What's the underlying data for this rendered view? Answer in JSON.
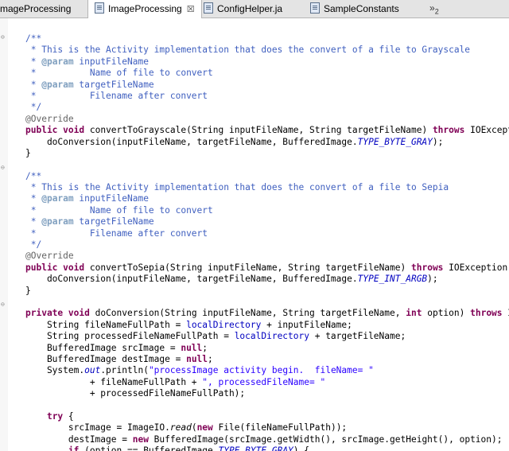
{
  "tabs": [
    {
      "label": "mageProcessing",
      "active": false,
      "icon": "none"
    },
    {
      "label": "ImageProcessing",
      "active": true,
      "icon": "java-file-icon",
      "close": "☒"
    },
    {
      "label": "ConfigHelper.ja",
      "active": false,
      "icon": "java-file-icon"
    },
    {
      "label": "SampleConstants",
      "active": false,
      "icon": "java-file-icon"
    }
  ],
  "overflow": {
    "arrows": "»",
    "count": "2"
  },
  "code_lines": [
    [
      {
        "t": "/**",
        "c": "jd"
      }
    ],
    [
      {
        "t": " * This is the Activity implementation that does the convert of a file to Grayscale",
        "c": "jd"
      }
    ],
    [
      {
        "t": " * ",
        "c": "jd"
      },
      {
        "t": "@param",
        "c": "jdtag"
      },
      {
        "t": " inputFileName",
        "c": "jd"
      }
    ],
    [
      {
        "t": " *          Name of file to convert",
        "c": "jd"
      }
    ],
    [
      {
        "t": " * ",
        "c": "jd"
      },
      {
        "t": "@param",
        "c": "jdtag"
      },
      {
        "t": " targetFileName",
        "c": "jd"
      }
    ],
    [
      {
        "t": " *          Filename after convert",
        "c": "jd"
      }
    ],
    [
      {
        "t": " */",
        "c": "jd"
      }
    ],
    [
      {
        "t": "@Override",
        "c": "ann"
      }
    ],
    [
      {
        "t": "public",
        "c": "kw"
      },
      {
        "t": " ",
        "c": ""
      },
      {
        "t": "void",
        "c": "kw"
      },
      {
        "t": " convertToGrayscale(String inputFileName, String targetFileName) ",
        "c": ""
      },
      {
        "t": "throws",
        "c": "kw"
      },
      {
        "t": " IOExcept",
        "c": ""
      }
    ],
    [
      {
        "t": "    doConversion(inputFileName, targetFileName, BufferedImage.",
        "c": ""
      },
      {
        "t": "TYPE_BYTE_GRAY",
        "c": "sf"
      },
      {
        "t": ");",
        "c": ""
      }
    ],
    [
      {
        "t": "}",
        "c": ""
      }
    ],
    [
      {
        "t": "",
        "c": ""
      }
    ],
    [
      {
        "t": "/**",
        "c": "jd"
      }
    ],
    [
      {
        "t": " * This is the Activity implementation that does the convert of a file to Sepia",
        "c": "jd"
      }
    ],
    [
      {
        "t": " * ",
        "c": "jd"
      },
      {
        "t": "@param",
        "c": "jdtag"
      },
      {
        "t": " inputFileName",
        "c": "jd"
      }
    ],
    [
      {
        "t": " *          Name of file to convert",
        "c": "jd"
      }
    ],
    [
      {
        "t": " * ",
        "c": "jd"
      },
      {
        "t": "@param",
        "c": "jdtag"
      },
      {
        "t": " targetFileName",
        "c": "jd"
      }
    ],
    [
      {
        "t": " *          Filename after convert",
        "c": "jd"
      }
    ],
    [
      {
        "t": " */",
        "c": "jd"
      }
    ],
    [
      {
        "t": "@Override",
        "c": "ann"
      }
    ],
    [
      {
        "t": "public",
        "c": "kw"
      },
      {
        "t": " ",
        "c": ""
      },
      {
        "t": "void",
        "c": "kw"
      },
      {
        "t": " convertToSepia(String inputFileName, String targetFileName) ",
        "c": ""
      },
      {
        "t": "throws",
        "c": "kw"
      },
      {
        "t": " IOException",
        "c": ""
      }
    ],
    [
      {
        "t": "    doConversion(inputFileName, targetFileName, BufferedImage.",
        "c": ""
      },
      {
        "t": "TYPE_INT_ARGB",
        "c": "sf"
      },
      {
        "t": ");",
        "c": ""
      }
    ],
    [
      {
        "t": "}",
        "c": ""
      }
    ],
    [
      {
        "t": "",
        "c": ""
      }
    ],
    [
      {
        "t": "private",
        "c": "kw"
      },
      {
        "t": " ",
        "c": ""
      },
      {
        "t": "void",
        "c": "kw"
      },
      {
        "t": " doConversion(String inputFileName, String targetFileName, ",
        "c": ""
      },
      {
        "t": "int",
        "c": "kw"
      },
      {
        "t": " option) ",
        "c": ""
      },
      {
        "t": "throws",
        "c": "kw"
      },
      {
        "t": " I",
        "c": ""
      }
    ],
    [
      {
        "t": "    String fileNameFullPath = ",
        "c": ""
      },
      {
        "t": "localDirectory",
        "c": "fld"
      },
      {
        "t": " + inputFileName;",
        "c": ""
      }
    ],
    [
      {
        "t": "    String processedFileNameFullPath = ",
        "c": ""
      },
      {
        "t": "localDirectory",
        "c": "fld"
      },
      {
        "t": " + targetFileName;",
        "c": ""
      }
    ],
    [
      {
        "t": "    BufferedImage srcImage = ",
        "c": ""
      },
      {
        "t": "null",
        "c": "kw"
      },
      {
        "t": ";",
        "c": ""
      }
    ],
    [
      {
        "t": "    BufferedImage destImage = ",
        "c": ""
      },
      {
        "t": "null",
        "c": "kw"
      },
      {
        "t": ";",
        "c": ""
      }
    ],
    [
      {
        "t": "    System.",
        "c": ""
      },
      {
        "t": "out",
        "c": "sf"
      },
      {
        "t": ".println(",
        "c": ""
      },
      {
        "t": "\"processImage activity begin.  fileName= \"",
        "c": "str"
      }
    ],
    [
      {
        "t": "            + fileNameFullPath + ",
        "c": ""
      },
      {
        "t": "\", processedFileName= \"",
        "c": "str"
      }
    ],
    [
      {
        "t": "            + processedFileNameFullPath);",
        "c": ""
      }
    ],
    [
      {
        "t": "",
        "c": ""
      }
    ],
    [
      {
        "t": "    ",
        "c": ""
      },
      {
        "t": "try",
        "c": "kw"
      },
      {
        "t": " {",
        "c": ""
      }
    ],
    [
      {
        "t": "        srcImage = ImageIO.",
        "c": ""
      },
      {
        "t": "read",
        "c": "st"
      },
      {
        "t": "(",
        "c": ""
      },
      {
        "t": "new",
        "c": "kw"
      },
      {
        "t": " File(fileNameFullPath));",
        "c": ""
      }
    ],
    [
      {
        "t": "        destImage = ",
        "c": ""
      },
      {
        "t": "new",
        "c": "kw"
      },
      {
        "t": " BufferedImage(srcImage.getWidth(), srcImage.getHeight(), option);",
        "c": ""
      }
    ],
    [
      {
        "t": "        ",
        "c": ""
      },
      {
        "t": "if",
        "c": "kw"
      },
      {
        "t": " (option == BufferedImage.",
        "c": ""
      },
      {
        "t": "TYPE_BYTE_GRAY",
        "c": "sf"
      },
      {
        "t": ") {",
        "c": ""
      }
    ]
  ],
  "fold_markers": [
    "⊖",
    "⊖",
    "⊖"
  ]
}
